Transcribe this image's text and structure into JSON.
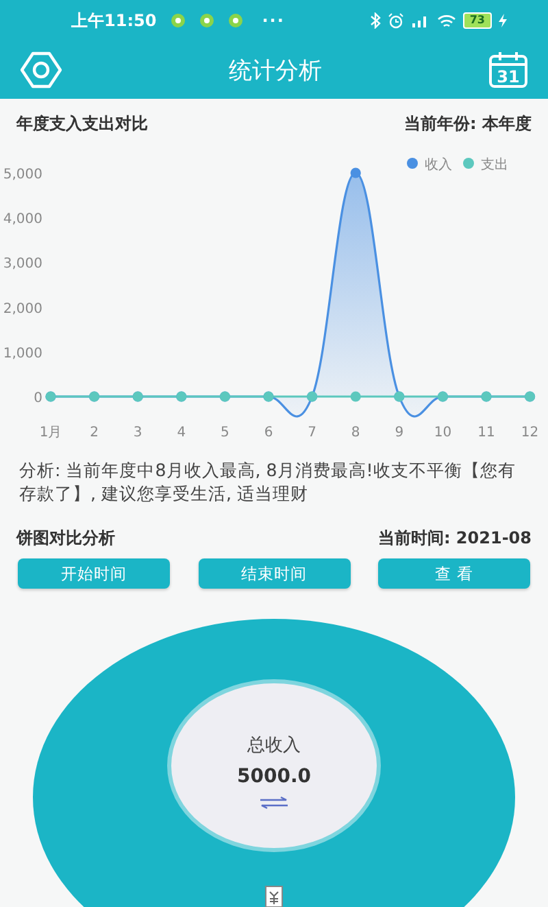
{
  "status_bar": {
    "time": "上午11:50",
    "more": "···",
    "battery": "73"
  },
  "header": {
    "title": "统计分析",
    "calendar_day": "31"
  },
  "annual": {
    "title": "年度支入支出对比",
    "year_label": "当前年份: 本年度",
    "chart_data": {
      "type": "area",
      "legend": "top-right",
      "categories": [
        "1月",
        "2",
        "3",
        "4",
        "5",
        "6",
        "7",
        "8",
        "9",
        "10",
        "11",
        "12"
      ],
      "yticks": [
        0,
        {
          "value": 1000,
          "label": "1,000"
        },
        {
          "value": 2000,
          "label": "2,000"
        },
        {
          "value": 3000,
          "label": "3,000"
        },
        {
          "value": 4000,
          "label": "4,000"
        },
        {
          "value": 5000,
          "label": "5,000"
        }
      ],
      "ylim": [
        0,
        5000
      ],
      "series": [
        {
          "name": "收入",
          "type": "area",
          "color": "#4a90e2",
          "marker": "circle",
          "values": [
            0,
            0,
            0,
            0,
            0,
            0,
            0,
            5000,
            0,
            0,
            0,
            0
          ]
        },
        {
          "name": "支出",
          "type": "line",
          "color": "#5cc8be",
          "marker": "circle",
          "values": [
            0,
            0,
            0,
            0,
            0,
            0,
            0,
            0,
            0,
            0,
            0,
            0
          ]
        }
      ]
    }
  },
  "analysis": "分析: 当前年度中8月收入最高, 8月消费最高!收支不平衡【您有存款了】, 建议您享受生活, 适当理财",
  "pie": {
    "title": "饼图对比分析",
    "time_label": "当前时间: 2021-08",
    "buttons": [
      "开始时间",
      "结束时间",
      "查 看"
    ],
    "center_label": "总收入",
    "center_value": "5000.0"
  }
}
